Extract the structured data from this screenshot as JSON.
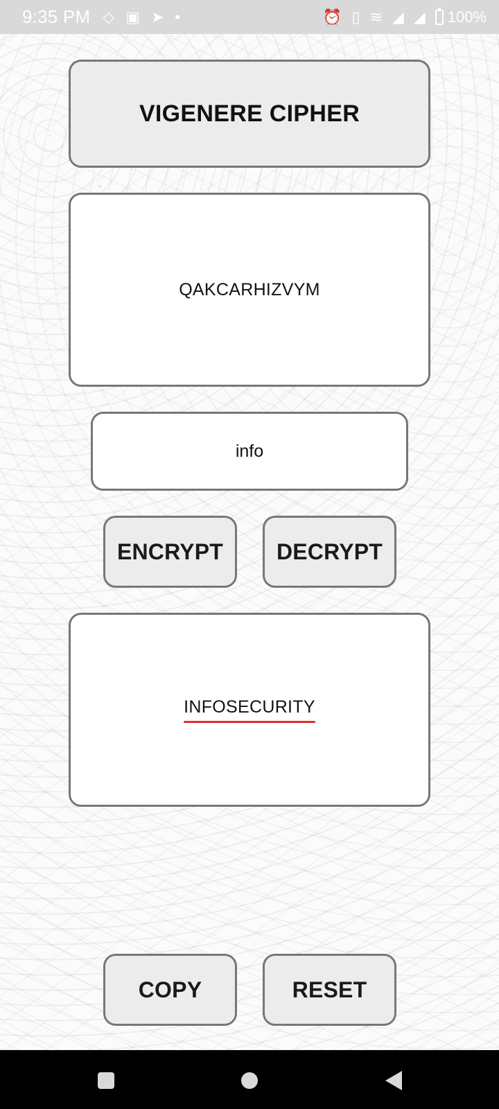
{
  "status_bar": {
    "time": "9:35 PM",
    "left_icons": [
      "binance-icon",
      "box-icon",
      "telegram-icon",
      "dot-icon"
    ],
    "right_icons": [
      "alarm-icon",
      "vibrate-icon",
      "wifi-icon",
      "signal-4g-icon",
      "signal-4g-icon"
    ],
    "battery_percent": "100%"
  },
  "app": {
    "title": "VIGENERE CIPHER",
    "cipher_text": "QAKCARHIZVYM",
    "key": "info",
    "buttons": {
      "encrypt": "ENCRYPT",
      "decrypt": "DECRYPT",
      "copy": "COPY",
      "reset": "RESET"
    },
    "plain_text": "INFOSECURITY"
  },
  "nav_bar": {
    "buttons": [
      "recent-apps",
      "home",
      "back"
    ]
  },
  "colors": {
    "status_bar_bg": "#d9d9d9",
    "box_border": "#777777",
    "button_bg": "#ececec",
    "underline_red": "#e12b2b",
    "nav_bar_bg": "#000000"
  }
}
